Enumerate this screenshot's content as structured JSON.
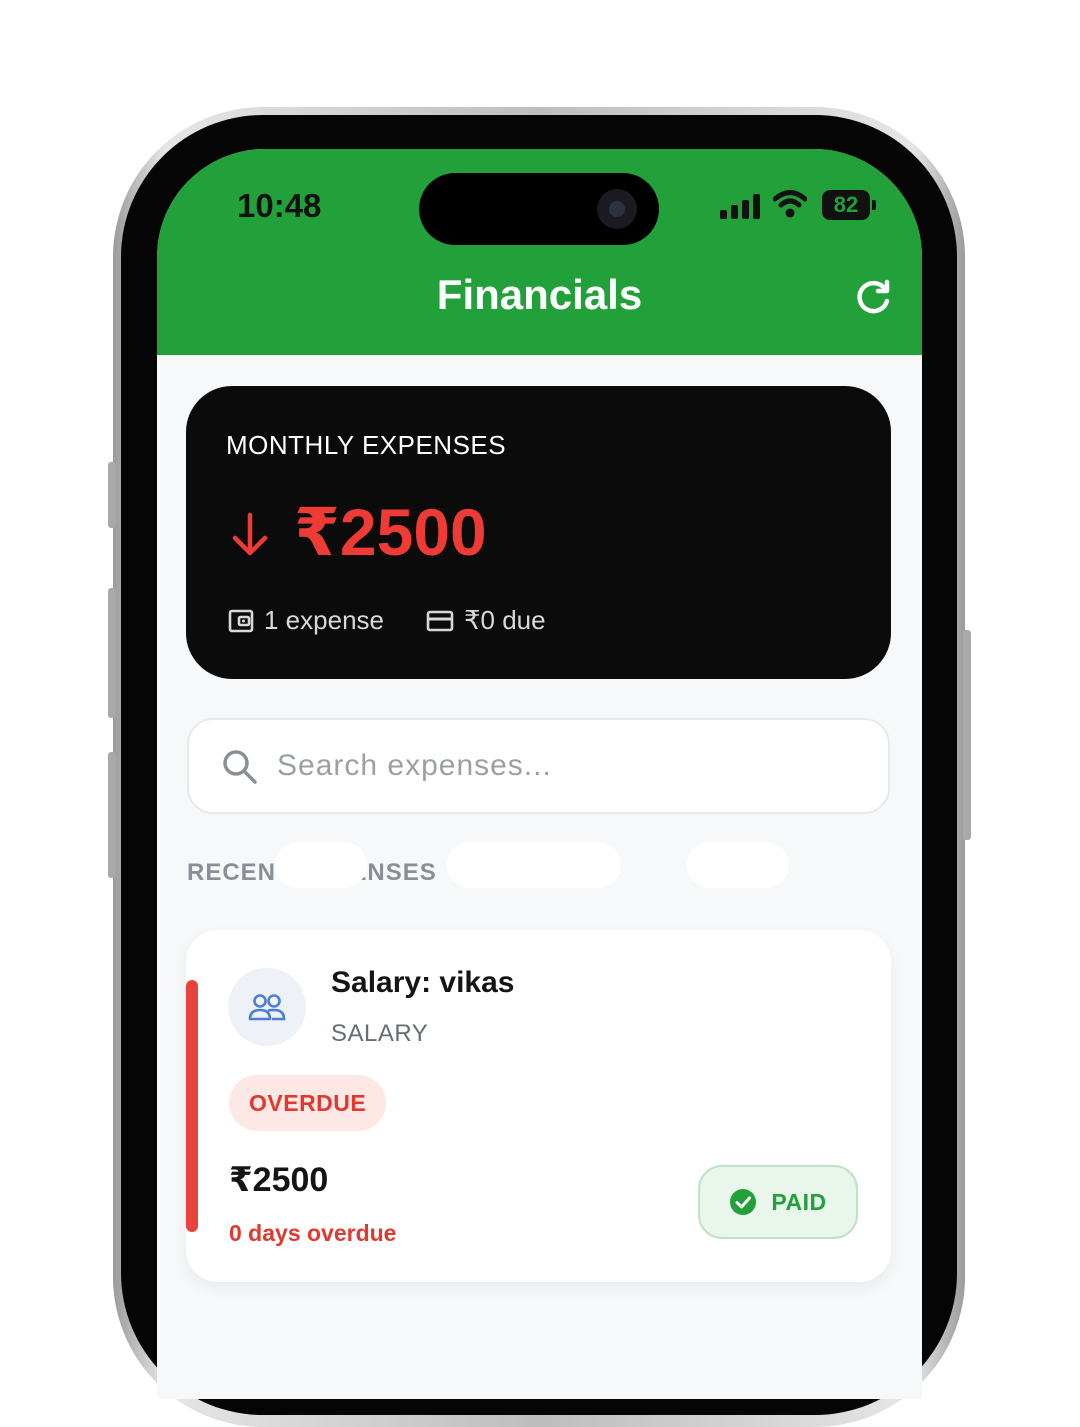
{
  "status_bar": {
    "time": "10:48",
    "battery": "82"
  },
  "header": {
    "title": "Financials"
  },
  "summary": {
    "label": "MONTHLY EXPENSES",
    "amount": "₹2500",
    "expense_count": "1 expense",
    "due": "₹0 due"
  },
  "search": {
    "placeholder": "Search expenses..."
  },
  "section": {
    "title": "RECENT EXPENSES"
  },
  "expenses": [
    {
      "title": "Salary: vikas",
      "category": "SALARY",
      "status_badge": "OVERDUE",
      "amount": "₹2500",
      "overdue_text": "0 days overdue",
      "action_label": "PAID"
    }
  ],
  "colors": {
    "brand_green": "#22a03a",
    "expense_red": "#ef3b36",
    "card_dark": "#0b0b0b"
  }
}
